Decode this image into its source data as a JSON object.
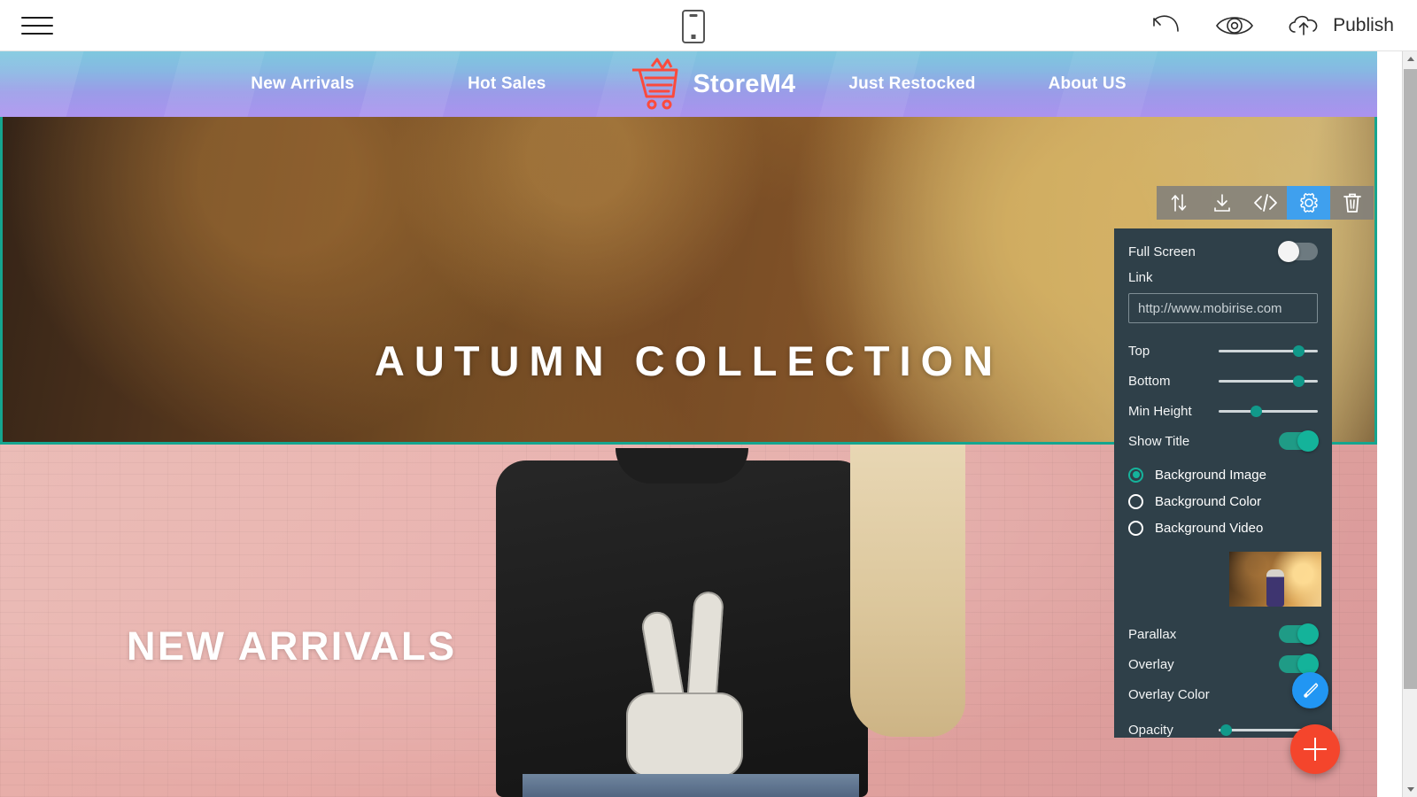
{
  "appbar": {
    "menu_icon": "hamburger-menu-icon",
    "mobile_preview_icon": "mobile-preview-icon",
    "undo_icon": "undo-icon",
    "preview_icon": "eye-preview-icon",
    "publish_icon": "cloud-upload-icon",
    "publish_label": "Publish"
  },
  "site_nav": {
    "brand": "StoreM4",
    "brand_icon": "shopping-cart-icon",
    "links_left": [
      "New Arrivals",
      "Hot Sales"
    ],
    "links_right": [
      "Just Restocked",
      "About US"
    ]
  },
  "hero": {
    "title": "AUTUMN COLLECTION"
  },
  "block2": {
    "title": "NEW ARRIVALS"
  },
  "block_toolbar": {
    "buttons": [
      {
        "name": "move-block-icon",
        "glyph": "↕"
      },
      {
        "name": "download-block-icon",
        "glyph": "↓"
      },
      {
        "name": "edit-code-icon",
        "glyph": "</>"
      },
      {
        "name": "block-settings-gear-icon",
        "glyph": "⚙"
      },
      {
        "name": "delete-block-icon",
        "glyph": "🗑"
      }
    ],
    "active_index": 3
  },
  "panel": {
    "full_screen_label": "Full Screen",
    "full_screen_state": "off",
    "link_label": "Link",
    "link_value": "http://www.mobirise.com",
    "link_placeholder": "http://www.mobirise.com",
    "top_label": "Top",
    "top_value": 75,
    "bottom_label": "Bottom",
    "bottom_value": 75,
    "min_height_label": "Min Height",
    "min_height_value": 32,
    "show_title_label": "Show Title",
    "show_title_state": "on",
    "background_options": [
      {
        "label": "Background Image",
        "selected": true
      },
      {
        "label": "Background Color",
        "selected": false
      },
      {
        "label": "Background Video",
        "selected": false
      }
    ],
    "thumbnail_name": "background-image-thumbnail",
    "parallax_label": "Parallax",
    "parallax_state": "on",
    "overlay_label": "Overlay",
    "overlay_state": "on",
    "overlay_color_label": "Overlay Color",
    "overlay_color_value": "#000000",
    "opacity_label": "Opacity",
    "opacity_value": 5
  },
  "fabs": {
    "pen_icon": "pen-edit-icon",
    "add_icon": "add-block-plus-icon"
  },
  "colors": {
    "panel_bg": "#2f4049",
    "accent_teal": "#15b39b",
    "active_blue": "#3fa0ee",
    "fab_red": "#f4452c",
    "fab_blue": "#2196f3",
    "selection_border": "#15a58f",
    "brand_red": "#fb4a3c"
  }
}
